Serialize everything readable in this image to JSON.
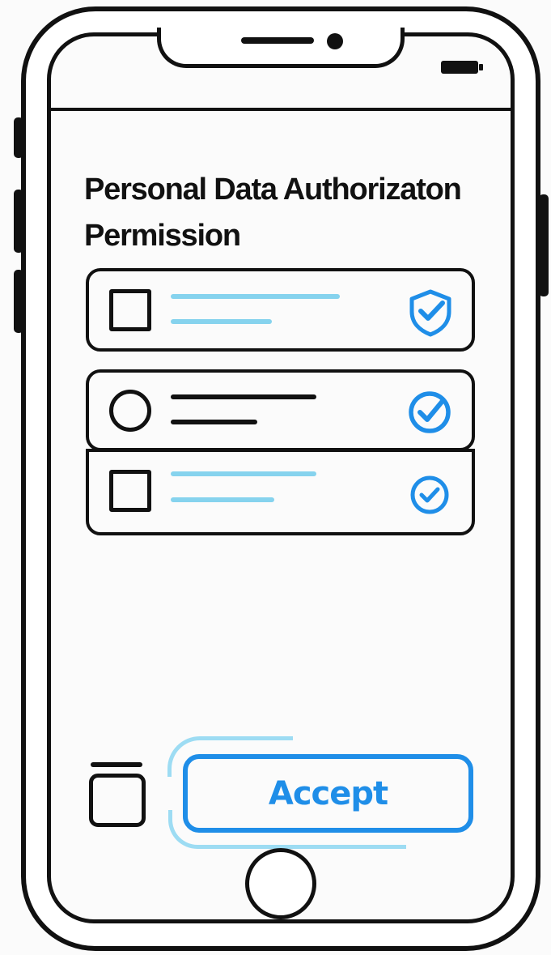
{
  "page": {
    "title": "Personal Data Authorizaton Permission"
  },
  "permissions": [
    {
      "control": "checkbox",
      "text_color": "#86d3ee",
      "badge": "shield-check-icon"
    },
    {
      "control": "radio",
      "text_color": "#111111",
      "badge": "check-circle-icon"
    },
    {
      "control": "checkbox",
      "text_color": "#86d3ee",
      "badge": "check-circle-icon"
    }
  ],
  "footer": {
    "accept_label": "Accept"
  },
  "colors": {
    "accent": "#1f8ee8",
    "accent_light": "#86d3ee",
    "ink": "#111111"
  }
}
